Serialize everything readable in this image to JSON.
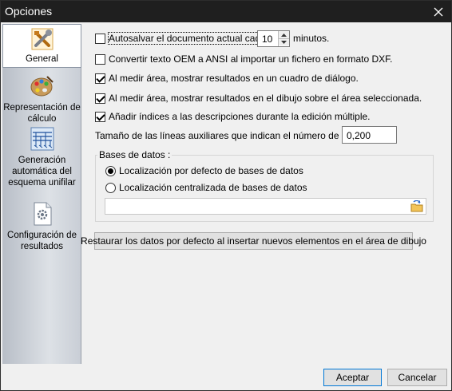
{
  "window": {
    "title": "Opciones"
  },
  "sidebar": {
    "items": [
      {
        "label": "General",
        "icon": "tools-icon",
        "active": true
      },
      {
        "label": "Representación de cálculo",
        "icon": "palette-icon",
        "active": false
      },
      {
        "label": "Generación automática del esquema unifilar",
        "icon": "schematic-icon",
        "active": false
      },
      {
        "label": "Configuración de resultados",
        "icon": "gear-document-icon",
        "active": false
      }
    ]
  },
  "options": {
    "autosave_label": "Autosalvar el documento actual cada",
    "autosave_checked": false,
    "autosave_value": "10",
    "autosave_unit": "minutos.",
    "convert_oem_label": "Convertir texto OEM a ANSI al importar un fichero en formato DXF.",
    "convert_oem_checked": false,
    "measure_dialog_label": "Al medir área, mostrar resultados en un cuadro de diálogo.",
    "measure_dialog_checked": true,
    "measure_drawing_label": "Al medir área, mostrar resultados en el dibujo sobre el área seleccionada.",
    "measure_drawing_checked": true,
    "add_indices_label": "Añadir índices a las descripciones durante la edición múltiple.",
    "add_indices_checked": true,
    "aux_lines_label": "Tamaño de las líneas auxiliares que indican el número de polos:",
    "aux_lines_value": "0,200"
  },
  "databases": {
    "group_title": "Bases de datos :",
    "default_label": "Localización por defecto de bases de datos",
    "centralized_label": "Localización centralizada de bases de datos",
    "selected": "default",
    "path_value": ""
  },
  "restore_button_label": "Restaurar los datos por defecto al insertar nuevos elementos en el área de dibujo",
  "footer": {
    "accept_label": "Aceptar",
    "cancel_label": "Cancelar"
  }
}
